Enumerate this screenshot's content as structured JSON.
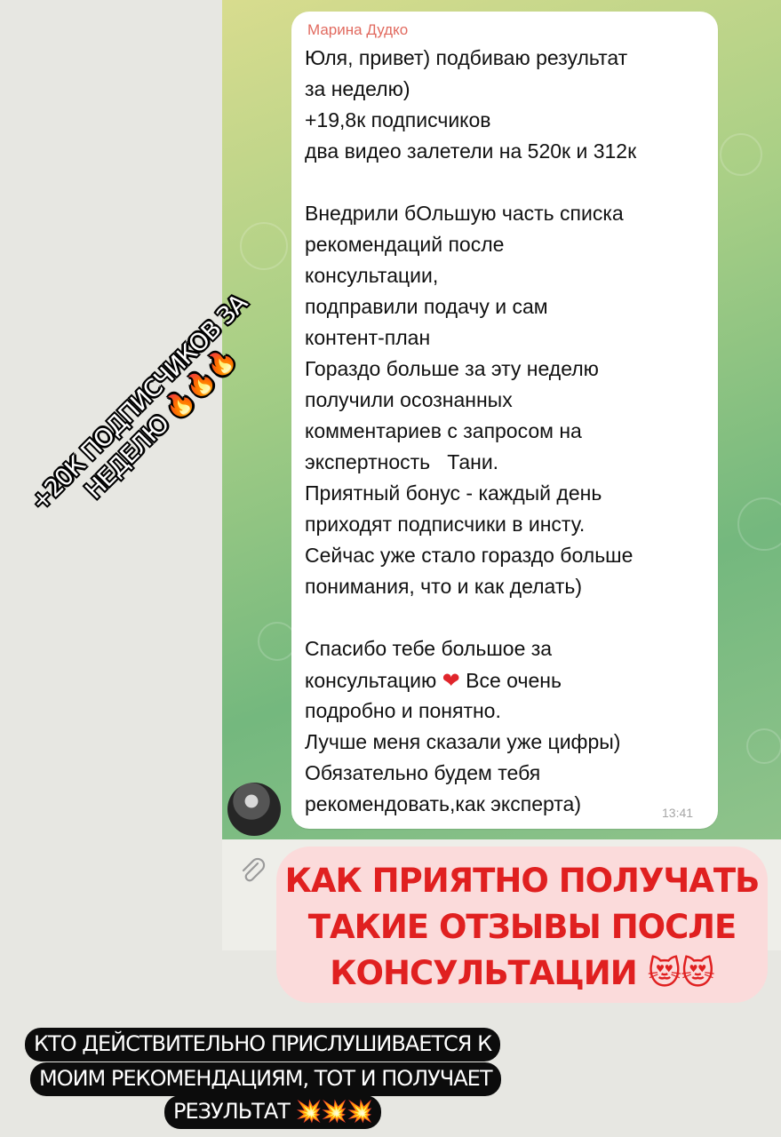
{
  "message": {
    "sender": "Марина Дудко",
    "time": "13:41",
    "lines": [
      "Юля, привет) подбиваю результат",
      "за неделю)",
      "+19,8к подписчиков",
      "два видео залетели на 520к и 312к",
      "Внедрили бОльшую часть списка",
      "рекомендаций после",
      "консультации,",
      "подправили подачу и сам",
      "контент-план",
      "Гораздо больше за эту неделю",
      "получили осознанных",
      "комментариев с запросом на",
      "экспертность   Тани.",
      "Приятный бонус - каждый день",
      "приходят подписчики в инсту.",
      "Сейчас уже стало гораздо больше",
      "понимания, что и как делать)",
      "Спасибо тебе большое за",
      "консультацию",
      "Все очень",
      "подробно и понятно.",
      "Лучше меня сказали уже цифры)",
      "Обязательно будем тебя",
      "рекомендовать,как эксперта)"
    ],
    "heart_emoji": "❤"
  },
  "stickers": {
    "rotated": {
      "line1": "+20К ПОДПИСЧИКОВ ЗА",
      "line2": "НЕДЕЛЮ 🔥🔥🔥"
    },
    "red": {
      "line1": "КАК ПРИЯТНО ПОЛУЧАТЬ",
      "line2": "ТАКИЕ ОТЗЫВЫ ПОСЛЕ",
      "line3": "КОНСУЛЬТАЦИИ 😻😻"
    },
    "black": {
      "line1": "КТО ДЕЙСТВИТЕЛЬНО ПРИСЛУШИВАЕТСЯ К",
      "line2": "МОИМ РЕКОМЕНДАЦИЯМ, ТОТ И ПОЛУЧАЕТ",
      "line3": "РЕЗУЛЬТАТ 💥💥💥"
    }
  },
  "icons": {
    "attach": "paperclip-icon",
    "avatar": "avatar"
  }
}
